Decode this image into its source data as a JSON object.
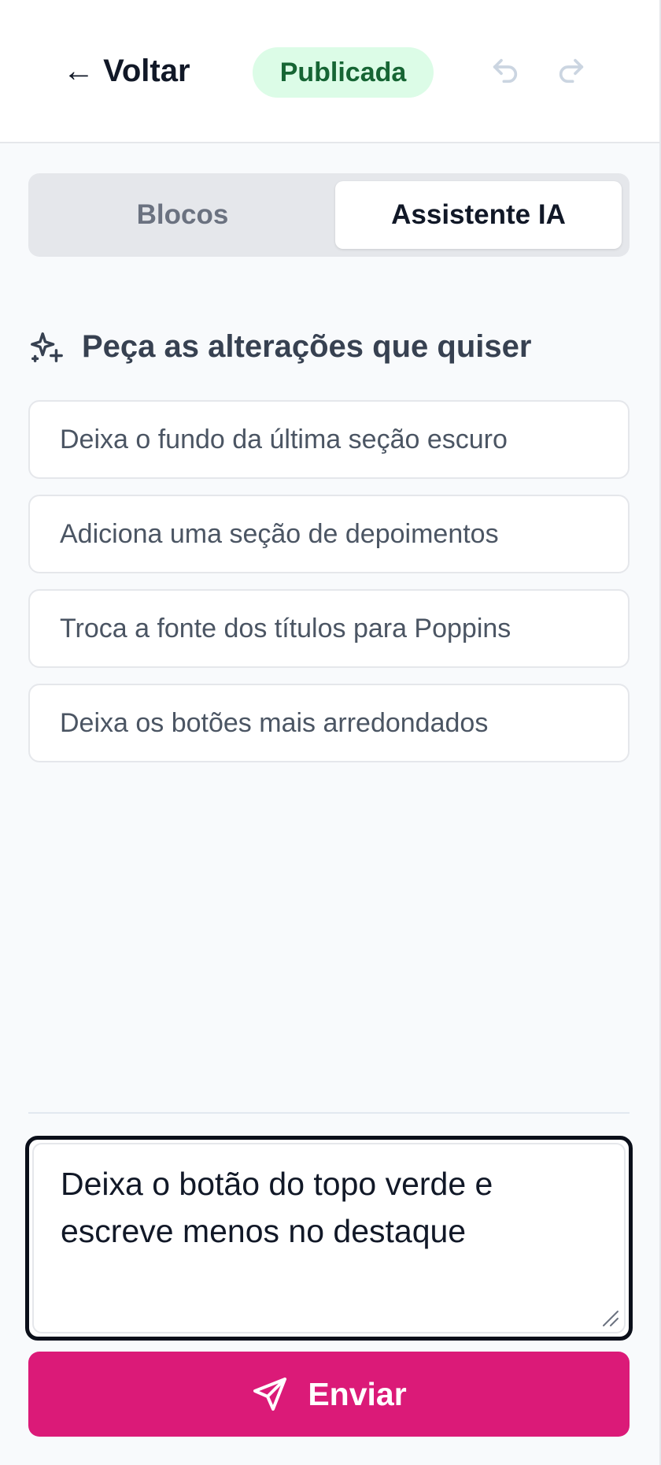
{
  "header": {
    "back_label": "← Voltar",
    "status": "Publicada",
    "undo_icon": "undo-icon",
    "redo_icon": "redo-icon"
  },
  "tabs": [
    {
      "label": "Blocos",
      "active": false
    },
    {
      "label": "Assistente IA",
      "active": true
    }
  ],
  "assistant": {
    "icon": "sparkles-icon",
    "heading": "Peça as alterações que quiser",
    "suggestions": [
      "Deixa o fundo da última seção escuro",
      "Adiciona uma seção de depoimentos",
      "Troca a fonte dos títulos para Poppins",
      "Deixa os botões mais arredondados"
    ]
  },
  "composer": {
    "value": "Deixa o botão do topo verde e escreve menos no destaque",
    "send_label": "Enviar",
    "send_icon": "send-icon"
  },
  "colors": {
    "accent": "#db1a78",
    "badge_bg": "#dcfce7",
    "badge_text": "#166534",
    "panel_bg": "#f8fafc"
  }
}
